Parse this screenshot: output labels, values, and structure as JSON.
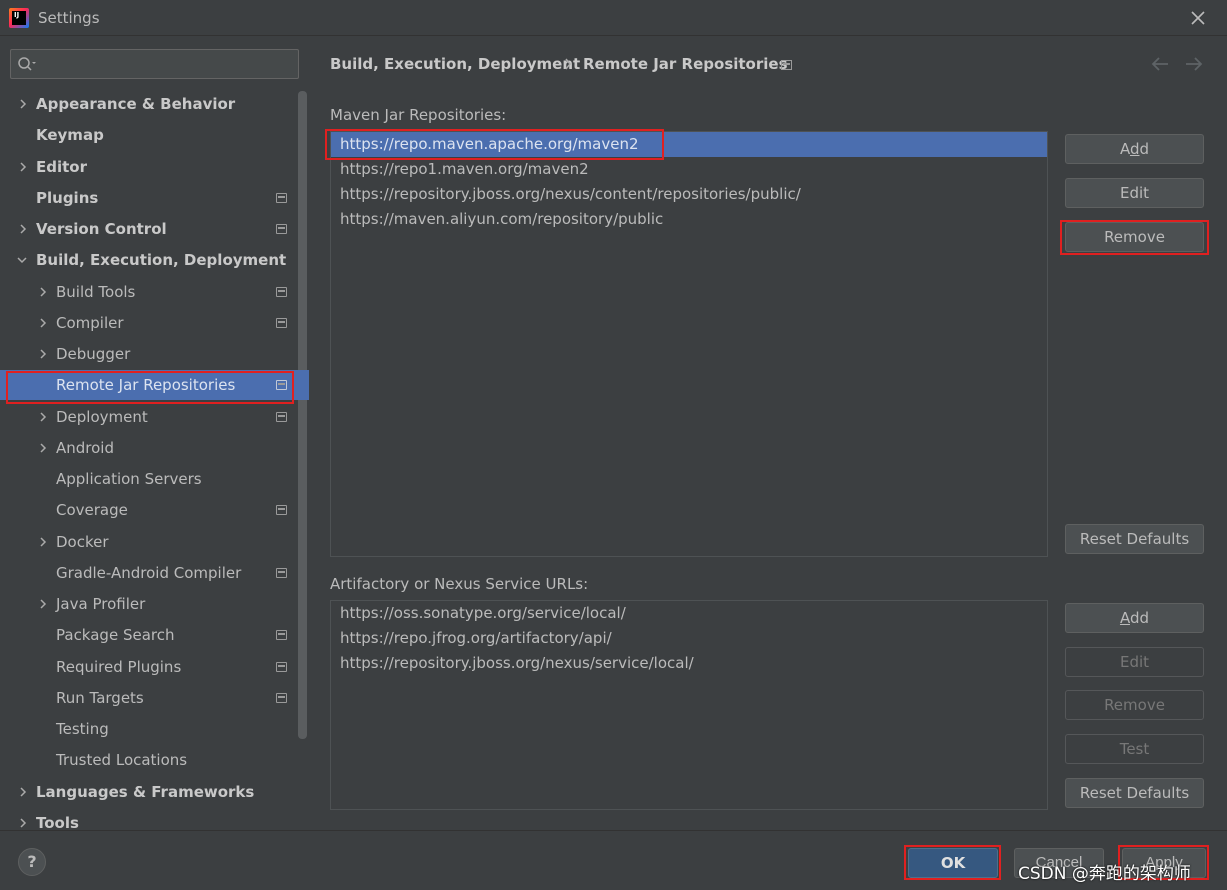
{
  "window": {
    "title": "Settings"
  },
  "sidebar": {
    "search_placeholder": "",
    "items": [
      {
        "label": "Appearance & Behavior"
      },
      {
        "label": "Keymap"
      },
      {
        "label": "Editor"
      },
      {
        "label": "Plugins"
      },
      {
        "label": "Version Control"
      },
      {
        "label": "Build, Execution, Deployment"
      },
      {
        "label": "Build Tools"
      },
      {
        "label": "Compiler"
      },
      {
        "label": "Debugger"
      },
      {
        "label": "Remote Jar Repositories"
      },
      {
        "label": "Deployment"
      },
      {
        "label": "Android"
      },
      {
        "label": "Application Servers"
      },
      {
        "label": "Coverage"
      },
      {
        "label": "Docker"
      },
      {
        "label": "Gradle-Android Compiler"
      },
      {
        "label": "Java Profiler"
      },
      {
        "label": "Package Search"
      },
      {
        "label": "Required Plugins"
      },
      {
        "label": "Run Targets"
      },
      {
        "label": "Testing"
      },
      {
        "label": "Trusted Locations"
      },
      {
        "label": "Languages & Frameworks"
      },
      {
        "label": "Tools"
      }
    ]
  },
  "breadcrumb": {
    "parent": "Build, Execution, Deployment",
    "current": "Remote Jar Repositories"
  },
  "maven": {
    "label": "Maven Jar Repositories:",
    "urls": [
      "https://repo.maven.apache.org/maven2",
      "https://repo1.maven.org/maven2",
      "https://repository.jboss.org/nexus/content/repositories/public/",
      "https://maven.aliyun.com/repository/public"
    ],
    "buttons": {
      "add_pre": "A",
      "add_u": "d",
      "add_post": "d",
      "edit": "Edit",
      "remove": "Remove",
      "reset": "Reset Defaults"
    }
  },
  "artifactory": {
    "label": "Artifactory or Nexus Service URLs:",
    "urls": [
      "https://oss.sonatype.org/service/local/",
      "https://repo.jfrog.org/artifactory/api/",
      "https://repository.jboss.org/nexus/service/local/"
    ],
    "buttons": {
      "add_pre": "",
      "add_u": "A",
      "add_post": "dd",
      "edit": "Edit",
      "remove": "Remove",
      "test": "Test",
      "reset": "Reset Defaults"
    }
  },
  "footer": {
    "help": "?",
    "ok": "OK",
    "cancel": "Cancel",
    "apply": "Apply",
    "watermark": "CSDN @奔跑的架构师"
  }
}
